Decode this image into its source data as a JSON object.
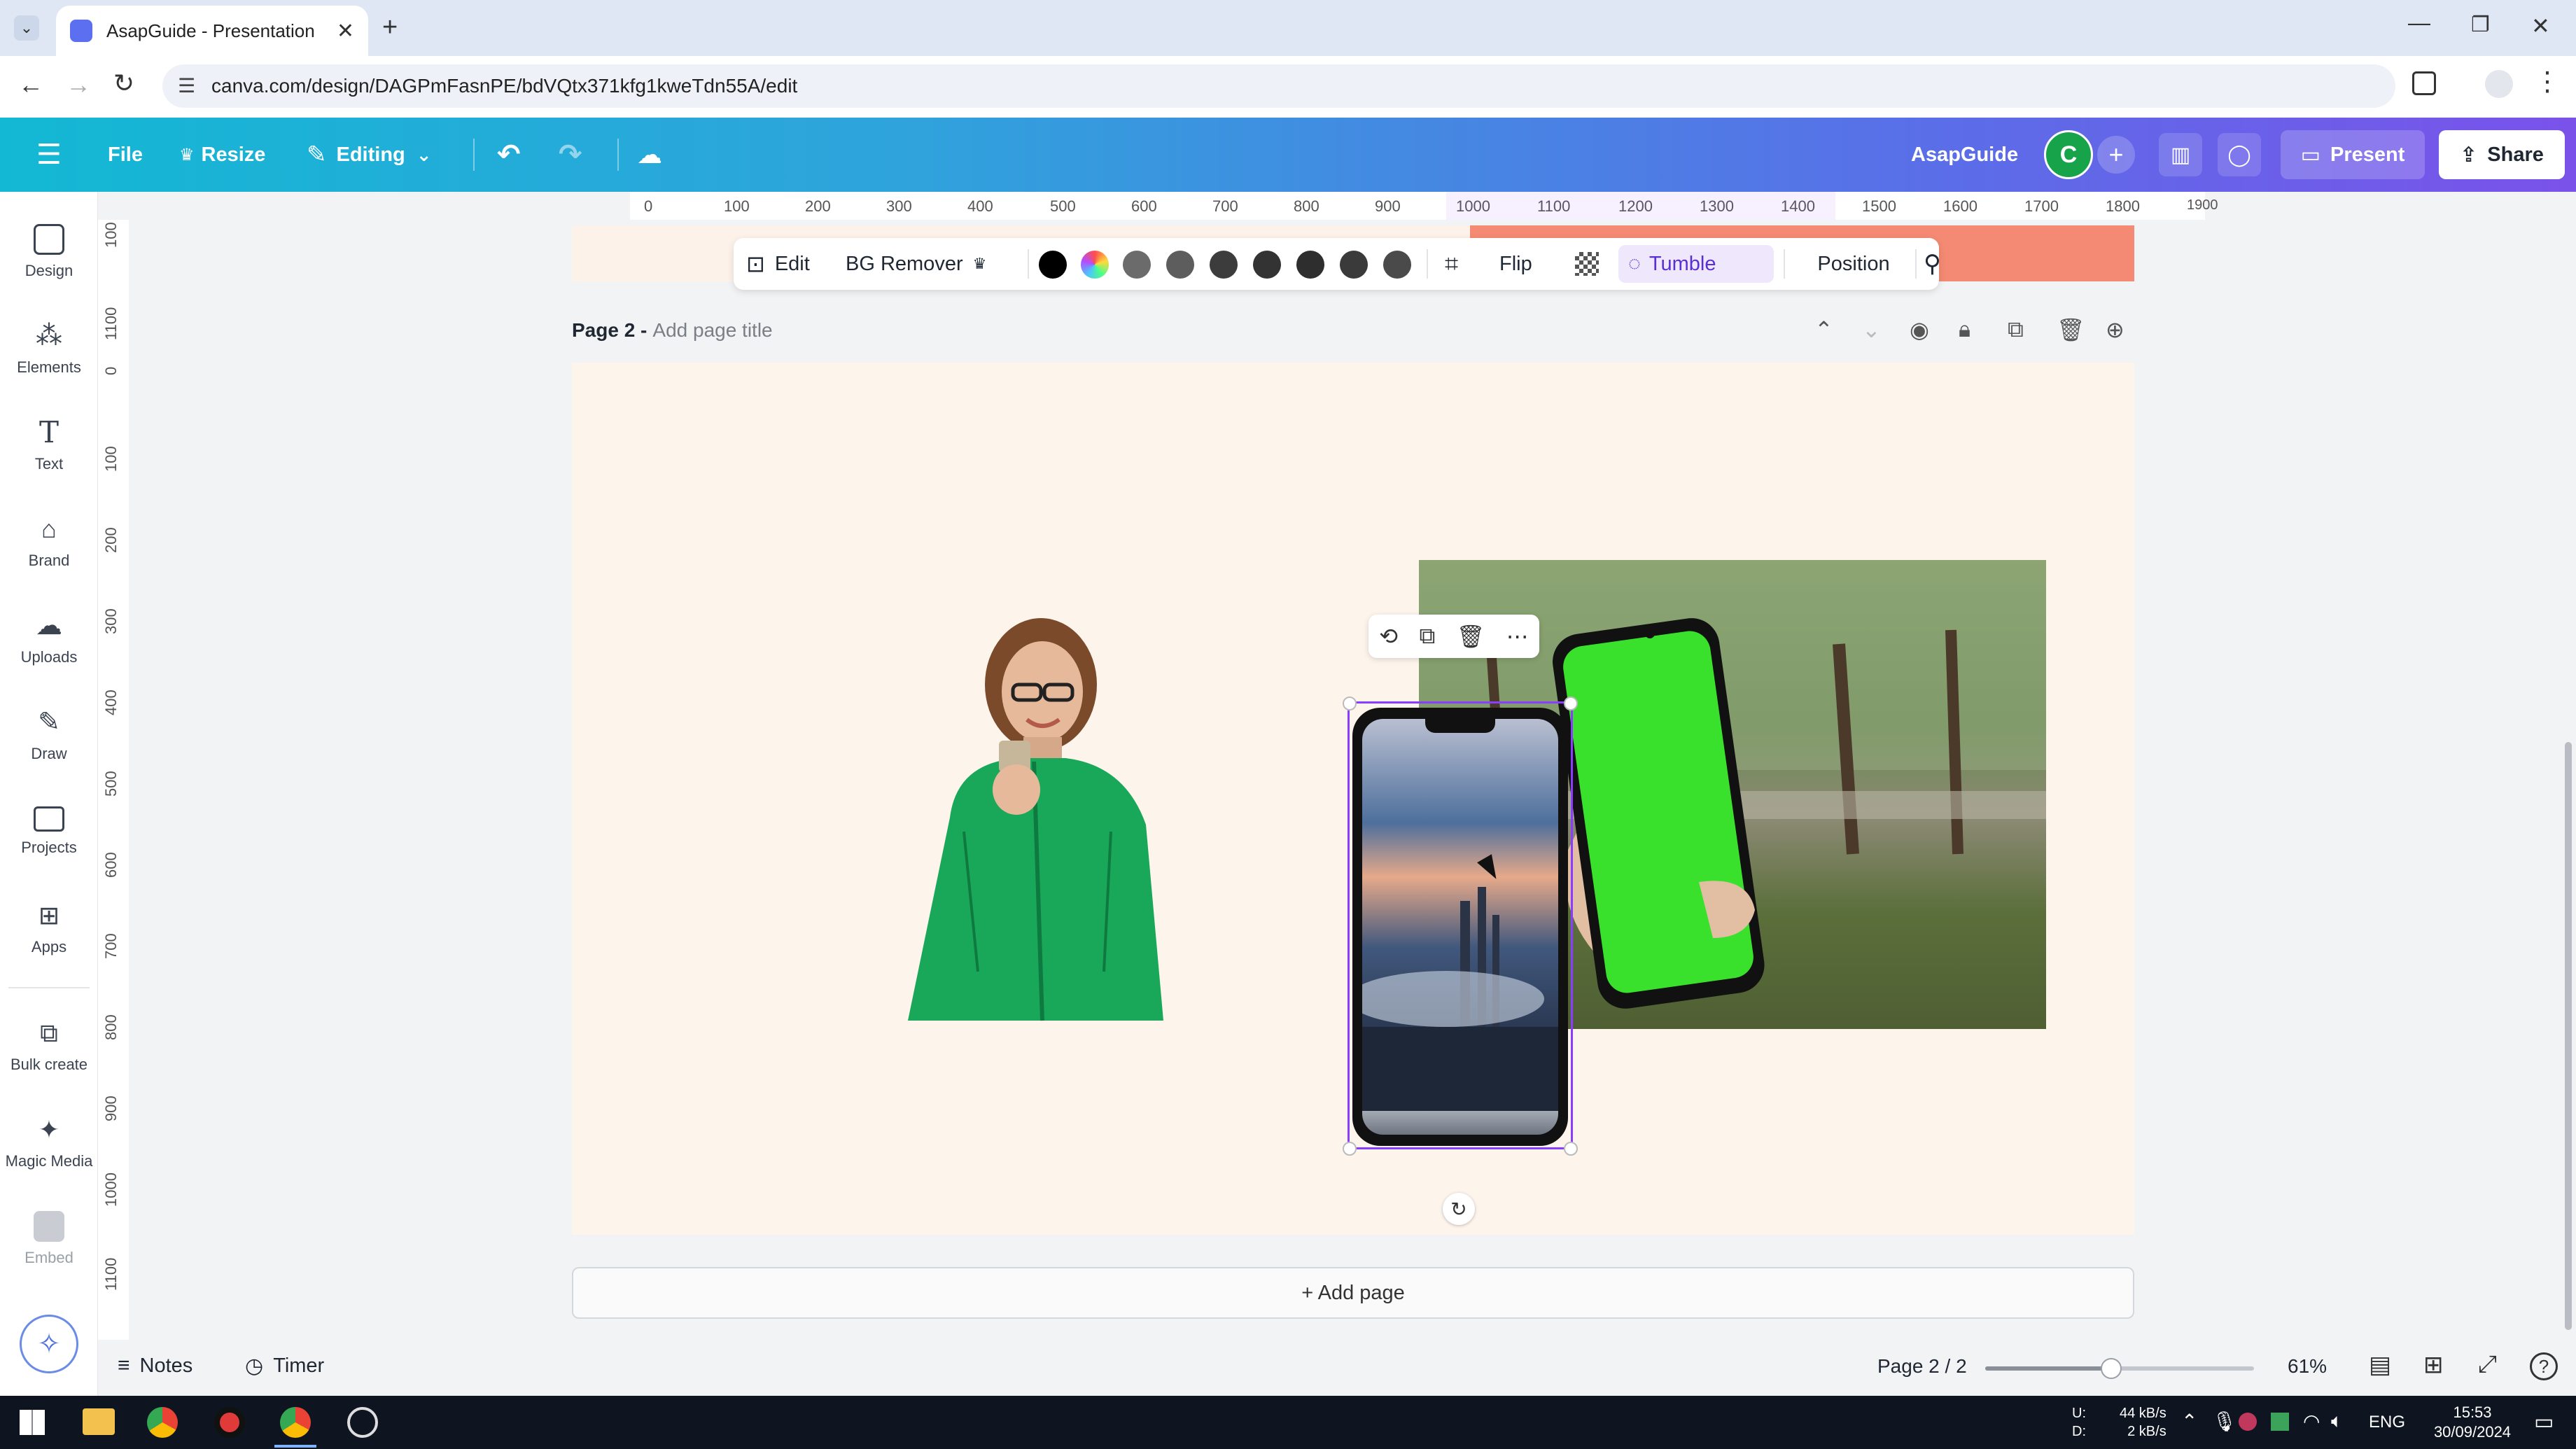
{
  "browser": {
    "tab_title": "AsapGuide - Presentation",
    "url": "canva.com/design/DAGPmFasnPE/bdVQtx371kfg1kweTdn55A/edit"
  },
  "header": {
    "file": "File",
    "resize": "Resize",
    "editing": "Editing",
    "team_name": "AsapGuide",
    "avatar_letter": "C",
    "present": "Present",
    "share": "Share"
  },
  "sidebar": {
    "items": [
      {
        "label": "Design",
        "icon": "design-icon"
      },
      {
        "label": "Elements",
        "icon": "elements-icon"
      },
      {
        "label": "Text",
        "icon": "text-icon"
      },
      {
        "label": "Brand",
        "icon": "brand-icon"
      },
      {
        "label": "Uploads",
        "icon": "uploads-icon"
      },
      {
        "label": "Draw",
        "icon": "draw-icon"
      },
      {
        "label": "Projects",
        "icon": "projects-icon"
      },
      {
        "label": "Apps",
        "icon": "apps-icon"
      },
      {
        "label": "Bulk create",
        "icon": "bulk-create-icon"
      },
      {
        "label": "Magic Media",
        "icon": "magic-media-icon"
      },
      {
        "label": "Embed",
        "icon": "embed-icon"
      }
    ]
  },
  "toolbar": {
    "edit": "Edit",
    "bg_remover": "BG Remover",
    "flip": "Flip",
    "tumble": "Tumble",
    "position": "Position",
    "swatches": [
      "#000000",
      "rainbow",
      "#6b6b6b",
      "#5d5d5d",
      "#3c3c3c",
      "#333333",
      "#2e2e2e",
      "#3a3a3a",
      "#4a4a4a"
    ]
  },
  "ruler": {
    "h_ticks": [
      "0",
      "100",
      "200",
      "300",
      "400",
      "500",
      "600",
      "700",
      "800",
      "900",
      "1000",
      "1100",
      "1200",
      "1300",
      "1400",
      "1500",
      "1600",
      "1700",
      "1800",
      "1900"
    ],
    "v_ticks": [
      "100",
      "1100",
      "0",
      "100",
      "200",
      "300",
      "400",
      "500",
      "600",
      "700",
      "800",
      "900",
      "1000",
      "1100"
    ]
  },
  "page": {
    "label": "Page 2 -",
    "title_placeholder": "Add page title",
    "add_page": "+ Add page"
  },
  "bottombar": {
    "notes": "Notes",
    "timer": "Timer",
    "page_indicator": "Page 2 / 2",
    "zoom": "61%",
    "zoom_fraction": 0.47
  },
  "taskbar": {
    "net_up": "44 kB/s",
    "net_down": "2 kB/s",
    "net_up_label": "U:",
    "net_down_label": "D:",
    "lang": "ENG",
    "time": "15:53",
    "date": "30/09/2024"
  },
  "colors": {
    "accent_purple": "#8b3dff",
    "page_bg": "#fdf4ec",
    "chroma_green": "#39e02c"
  }
}
